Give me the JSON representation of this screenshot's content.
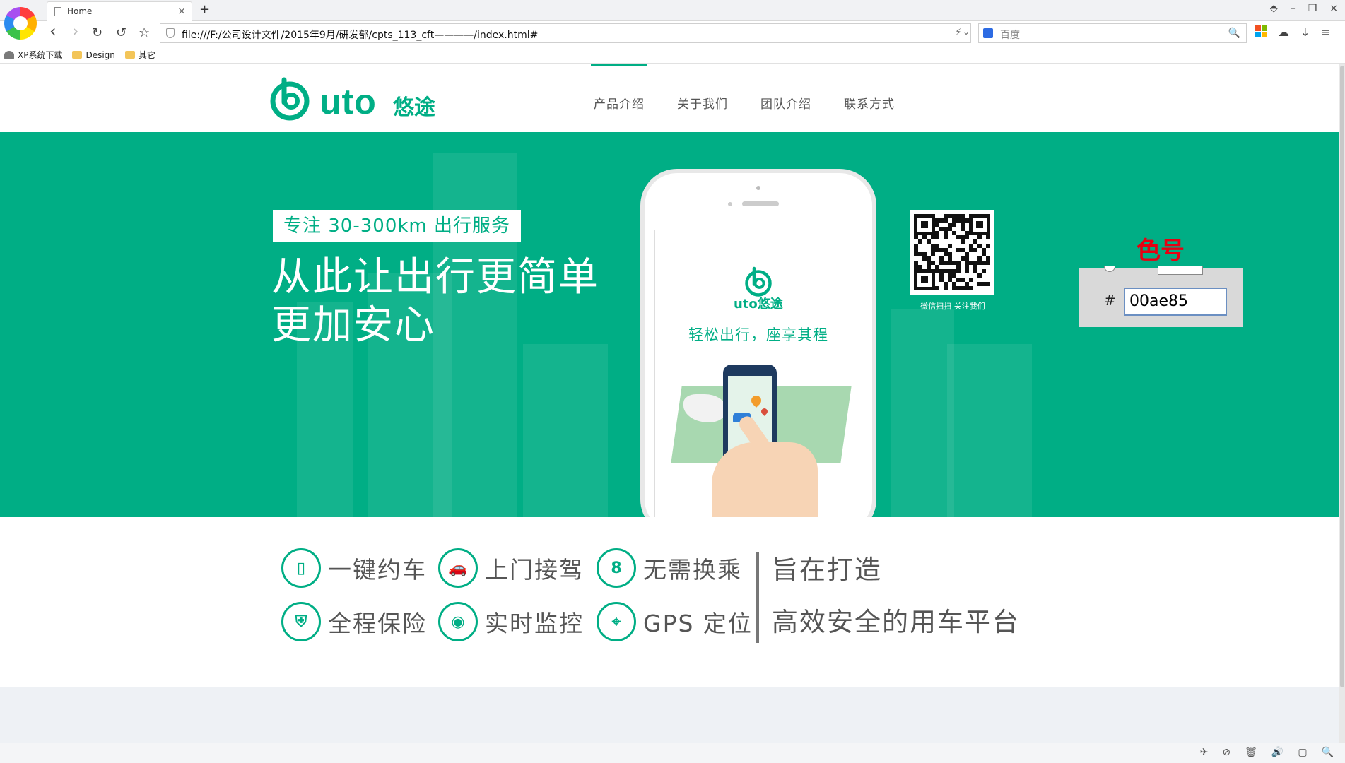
{
  "browser": {
    "tab_title": "Home",
    "tab_close": "×",
    "new_tab": "+",
    "window_controls": [
      "⬘",
      "–",
      "❐",
      "×"
    ],
    "nav": {
      "back": "‹",
      "forward": "›",
      "reload": "↻",
      "undo": "↺",
      "star": "☆"
    },
    "address": "file:///F:/公司设计文件/2015年9月/研发部/cpts_113_cft————/index.html#",
    "address_bolt": "⚡",
    "address_dropdown": "⌄",
    "search_placeholder": "百度",
    "search_icon": "🔍",
    "tools": {
      "cloud": "☁",
      "download": "↓",
      "menu": "≡"
    },
    "bookmarks": [
      {
        "label": "XP系统下载",
        "icon": "xp-icon"
      },
      {
        "label": "Design",
        "icon": "folder-icon"
      },
      {
        "label": "其它",
        "icon": "folder-icon"
      }
    ],
    "status_icons": [
      "✈",
      "⊘",
      "🗑",
      "🔊",
      "▢",
      "🔍"
    ]
  },
  "site": {
    "logo_word": "uto",
    "logo_cn": "悠途",
    "menu": [
      "产品介绍",
      "关于我们",
      "团队介绍",
      "联系方式"
    ],
    "active_menu": 0,
    "hero": {
      "tag": "专注 30-300km 出行服务",
      "headline_1": "从此让出行更简单",
      "headline_2": "更加安心",
      "phone_logo_word": "uto悠途",
      "phone_slogan": "轻松出行，座享其程",
      "qr_caption": "微信扫扫 关注我们",
      "background": "#00ae85"
    },
    "annotation": {
      "label": "色号",
      "hash": "#",
      "value": "00ae85",
      "label_color": "#e60012"
    },
    "features": [
      {
        "label": "一键约车",
        "icon": "phone-icon",
        "glyph": "▯"
      },
      {
        "label": "上门接驾",
        "icon": "car-icon",
        "glyph": "🚗"
      },
      {
        "label": "无需换乘",
        "icon": "route-icon",
        "glyph": "8"
      },
      {
        "label": "全程保险",
        "icon": "shield-icon",
        "glyph": "⛨"
      },
      {
        "label": "实时监控",
        "icon": "camera-icon",
        "glyph": "◉"
      },
      {
        "label": "GPS 定位",
        "icon": "map-icon",
        "glyph": "⌖"
      }
    ],
    "mission_1": "旨在打造",
    "mission_2": "高效安全的用车平台",
    "accent_color": "#00ae85"
  }
}
